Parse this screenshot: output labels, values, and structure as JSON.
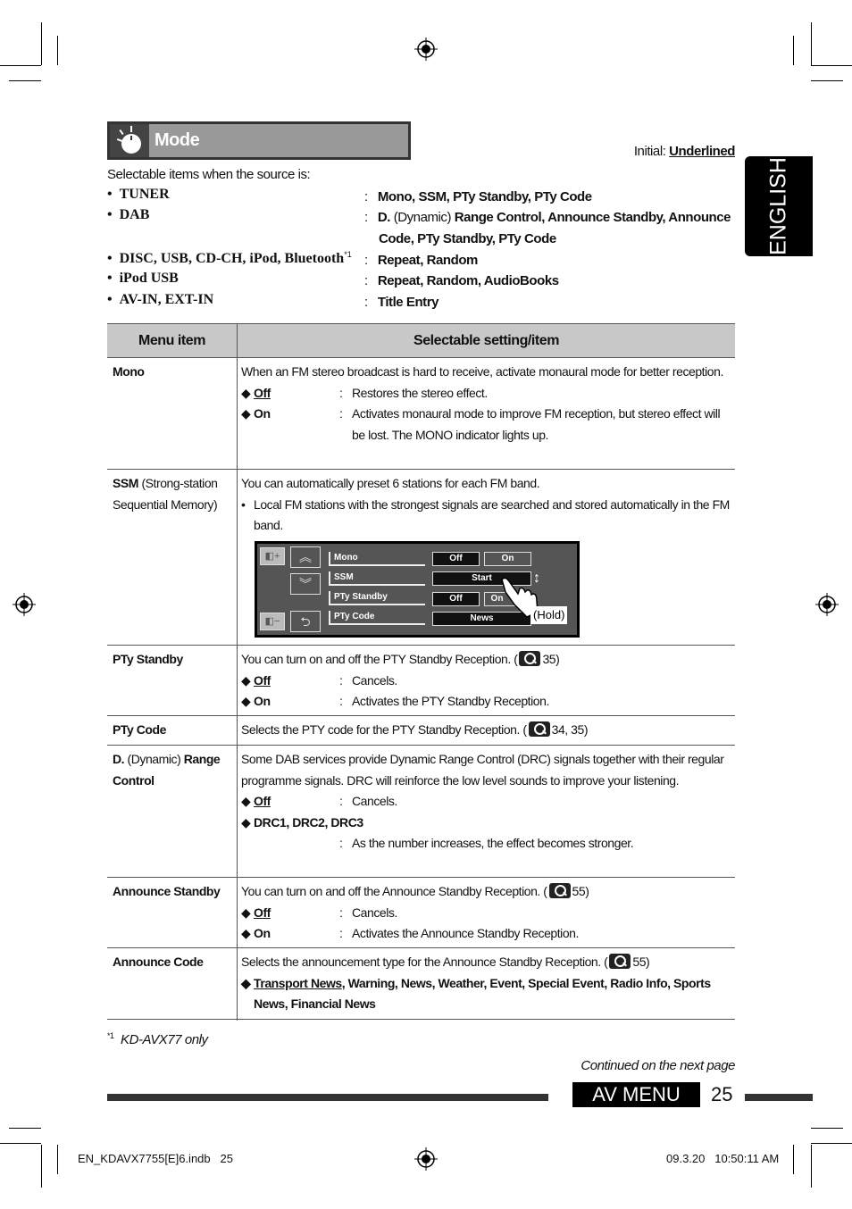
{
  "header": {
    "title": "Mode",
    "initial_label": "Initial: ",
    "initial_value": "Underlined",
    "language_tab": "ENGLISH"
  },
  "intro": "Selectable items when the source is:",
  "sources": [
    {
      "name": "TUNER",
      "items": "Mono, SSM, PTy Standby, PTy Code"
    },
    {
      "name": "DAB",
      "items_bold1": "D.",
      "items_normal": " (Dynamic) ",
      "items_bold2": "Range Control, Announce Standby, Announce",
      "items_line2": "Code, PTy Standby, PTy Code"
    },
    {
      "name": "DISC, USB, CD-CH, iPod, Bluetooth",
      "note": "*1",
      "items": "Repeat, Random"
    },
    {
      "name": "iPod USB",
      "items": "Repeat, Random, AudioBooks"
    },
    {
      "name": "AV-IN, EXT-IN",
      "items": "Title Entry"
    }
  ],
  "table": {
    "headers": [
      "Menu item",
      "Selectable setting/item"
    ],
    "rows": [
      {
        "item": "Mono",
        "desc": "When an FM stereo broadcast is hard to receive, activate monaural mode for better reception.",
        "options": [
          {
            "label": "Off",
            "desc": "Restores the stereo effect."
          },
          {
            "label": "On",
            "desc": "Activates monaural mode to improve FM reception, but stereo effect will be lost. The MONO indicator lights up."
          }
        ]
      },
      {
        "item": "SSM",
        "item_sub": " (Strong-station Sequential Memory)",
        "desc": "You can automatically preset 6 stations for each FM band.",
        "bullet": "Local FM stations with the strongest signals are searched and stored automatically in the FM band."
      },
      {
        "item": "PTy Standby",
        "desc": "You can turn on and off the PTY Standby Reception. (",
        "ref": "35)",
        "options": [
          {
            "label": "Off",
            "desc": "Cancels."
          },
          {
            "label": "On",
            "desc": "Activates the PTY Standby Reception."
          }
        ]
      },
      {
        "item": "PTy Code",
        "desc": "Selects the PTY code for the PTY Standby Reception. (",
        "ref": "34, 35)"
      },
      {
        "item_b1": "D.",
        "item_n": " (Dynamic) ",
        "item_b2": "Range Control",
        "desc": "Some DAB services provide Dynamic Range Control (DRC) signals together with their regular programme signals. DRC will reinforce the low level sounds to improve your listening.",
        "options": [
          {
            "label": "Off",
            "desc": "Cancels."
          },
          {
            "label": "DRC1, DRC2, DRC3",
            "desc": "As the number increases, the effect becomes stronger."
          }
        ]
      },
      {
        "item": "Announce Standby",
        "desc": "You can turn on and off the Announce Standby Reception. (",
        "ref": "55)",
        "options": [
          {
            "label": "Off",
            "desc": "Cancels."
          },
          {
            "label": "On",
            "desc": "Activates the Announce Standby Reception."
          }
        ]
      },
      {
        "item": "Announce Code",
        "desc": "Selects the announcement type for the Announce Standby Reception. (",
        "ref": "55)",
        "opt_default": "Transport News",
        "opt_rest": ", Warning, News, Weather, Event, Special Event, Radio Info, Sports News, Financial News"
      }
    ]
  },
  "screen": {
    "rows": [
      "Mono",
      "SSM",
      "PTy Standby",
      "PTy Code"
    ],
    "mono_off": "Off",
    "mono_on": "On",
    "ssm_start": "Start",
    "pty_off": "Off",
    "pty_on": "On",
    "pty_code": "News",
    "hold": "(Hold)"
  },
  "footnote": {
    "mark": "*1",
    "text": "KD-AVX77 only"
  },
  "footer": {
    "continued": "Continued on the next page",
    "section": "AV MENU",
    "page": "25",
    "file": "EN_KDAVX7755[E]6.indb   25",
    "date": "09.3.20",
    "time": "10:50:11 AM"
  },
  "colors": {
    "header_bar": "#999999",
    "table_header": "#c8c8c8",
    "tab": "#000000"
  }
}
